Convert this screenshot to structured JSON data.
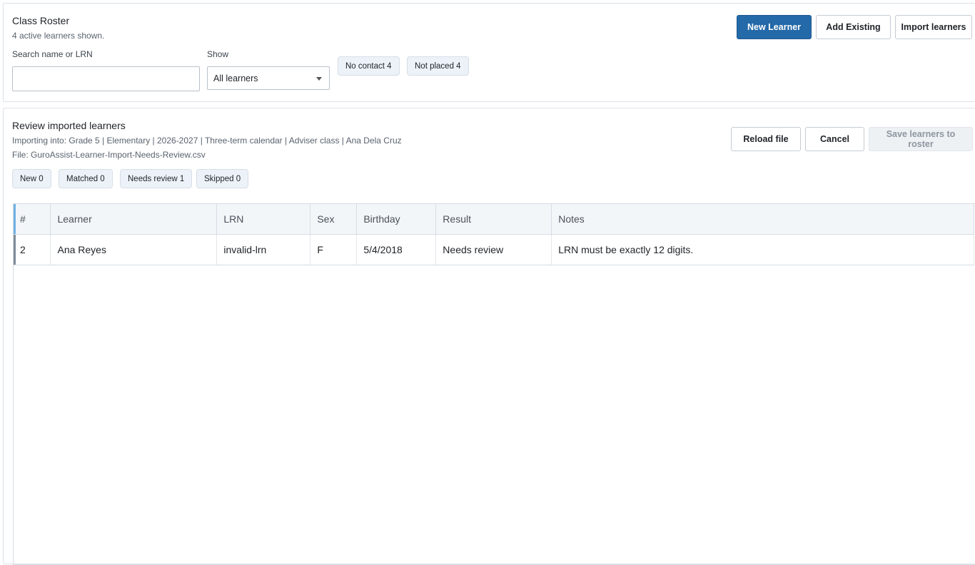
{
  "roster": {
    "title": "Class Roster",
    "subtitle": "4 active learners shown.",
    "search_label": "Search name or LRN",
    "search_value": "",
    "search_placeholder": "",
    "show_label": "Show",
    "show_selected": "All learners",
    "chips": {
      "no_contact": "No contact 4",
      "not_placed": "Not placed 4"
    },
    "buttons": {
      "new_learner": "New Learner",
      "add_existing": "Add Existing",
      "import_learners": "Import learners"
    }
  },
  "import_review": {
    "title": "Review imported learners",
    "context": "Importing into: Grade 5 | Elementary | 2026-2027 | Three-term calendar | Adviser class | Ana Dela Cruz",
    "file": "File: GuroAssist-Learner-Import-Needs-Review.csv",
    "chips": {
      "new": "New 0",
      "matched": "Matched 0",
      "needs_review": "Needs review 1",
      "skipped": "Skipped 0"
    },
    "buttons": {
      "reload": "Reload file",
      "cancel": "Cancel",
      "save": "Save learners to roster"
    },
    "table": {
      "headers": {
        "num": "#",
        "learner": "Learner",
        "lrn": "LRN",
        "sex": "Sex",
        "birthday": "Birthday",
        "result": "Result",
        "notes": "Notes"
      },
      "rows": [
        {
          "num": "2",
          "learner": "Ana Reyes",
          "lrn": "invalid-lrn",
          "sex": "F",
          "birthday": "5/4/2018",
          "result": "Needs review",
          "notes": "LRN must be exactly 12 digits."
        }
      ]
    }
  },
  "colors": {
    "primary": "#2469a8",
    "chip_bg": "#edf2f8",
    "header_accent": "#6fb1e3"
  },
  "icons": {
    "select_caret": "caret-down-icon"
  }
}
